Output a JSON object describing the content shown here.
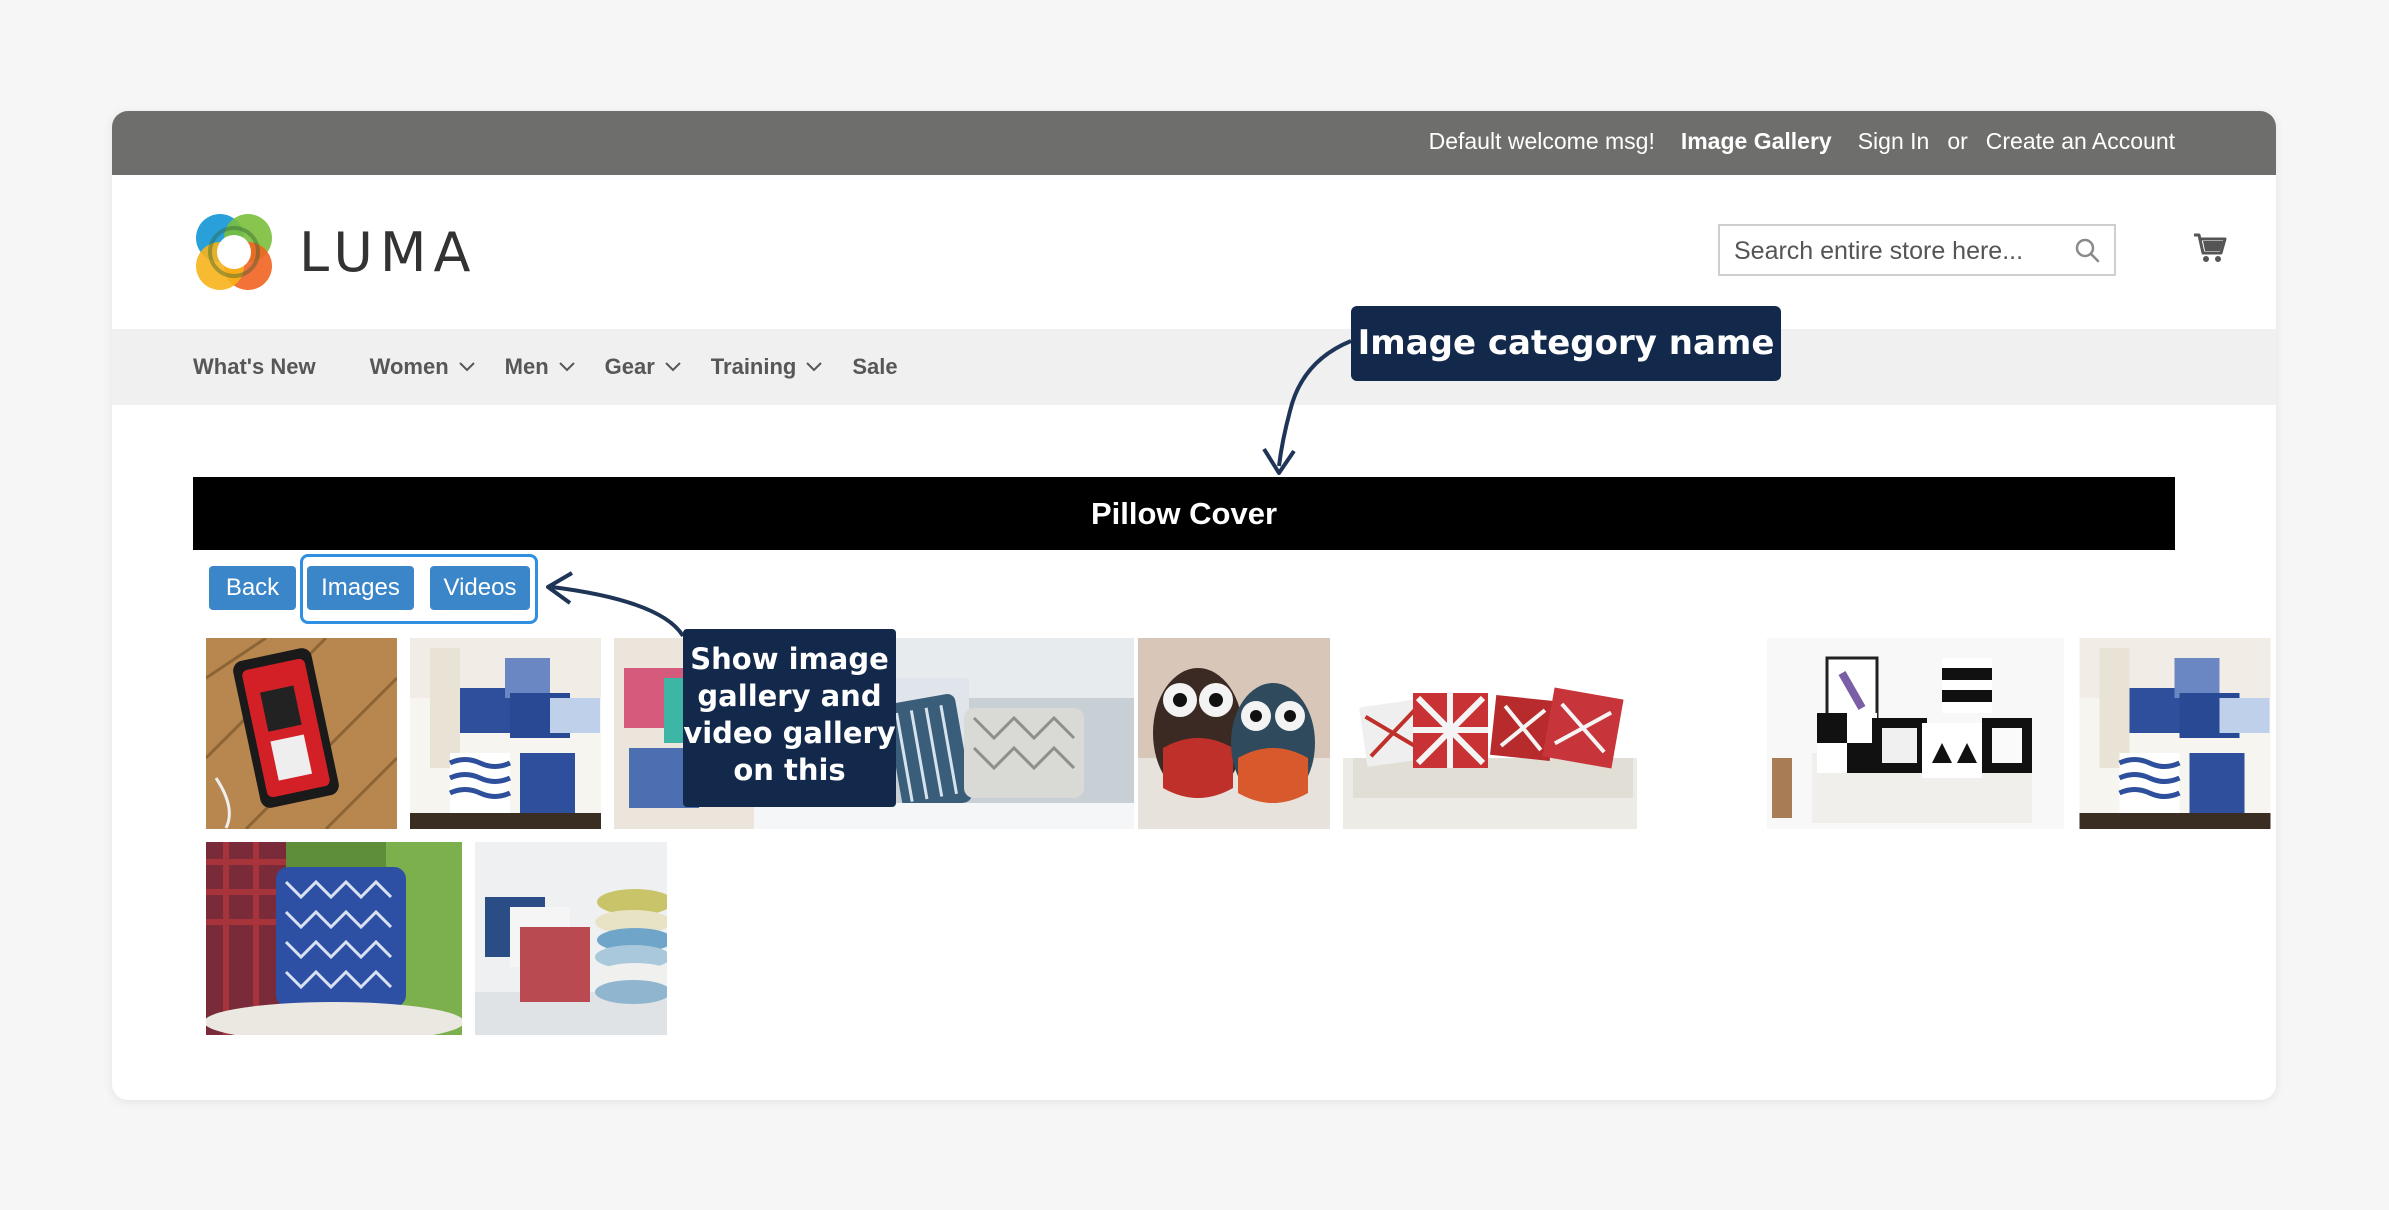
{
  "topbar": {
    "welcome": "Default welcome msg!",
    "image_gallery": "Image Gallery",
    "sign_in": "Sign In",
    "or": "or",
    "create_account": "Create an Account"
  },
  "header": {
    "logo_text": "LUMA",
    "search_placeholder": "Search entire store here...",
    "search_icon": "search-icon",
    "cart_icon": "cart-icon"
  },
  "nav": {
    "items": [
      {
        "label": "What's New",
        "has_dropdown": false
      },
      {
        "label": "Women",
        "has_dropdown": true
      },
      {
        "label": "Men",
        "has_dropdown": true
      },
      {
        "label": "Gear",
        "has_dropdown": true
      },
      {
        "label": "Training",
        "has_dropdown": true
      },
      {
        "label": "Sale",
        "has_dropdown": false
      }
    ]
  },
  "category": {
    "title": "Pillow Cover"
  },
  "buttons": {
    "back": "Back",
    "images": "Images",
    "videos": "Videos"
  },
  "annotations": {
    "category_label": "Image category name",
    "gallery_label": "Show image\ngallery and\nvideo gallery\non this"
  },
  "colors": {
    "topbar": "#6e6f6c",
    "nav_bg": "#f0f0f0",
    "button_blue": "#3b86c9",
    "callout_navy": "#13294b",
    "highlight_blue": "#2f8fe0"
  },
  "gallery": {
    "thumbnails": [
      "phone-case-image",
      "blue-pillows-sofa-image",
      "pillows-on-grey-sofa-image",
      "owl-pillows-image",
      "red-white-pillows-image",
      "black-white-pillows-image",
      "blue-pillows-sofa-image",
      "blue-pattern-pillow-image",
      "stacked-pillows-image"
    ]
  }
}
